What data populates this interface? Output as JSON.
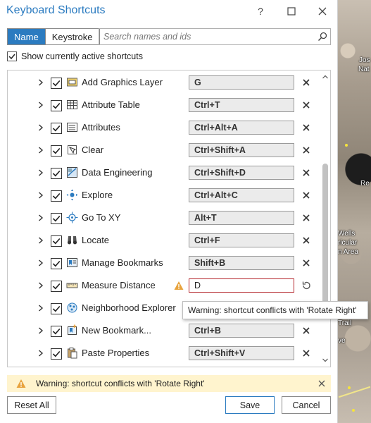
{
  "window": {
    "title": "Keyboard Shortcuts",
    "help_label": "?"
  },
  "toolbar": {
    "tab_name": "Name",
    "tab_keystroke": "Keystroke",
    "search_placeholder": "Search names and ids"
  },
  "show_active": {
    "label": "Show currently active shortcuts",
    "checked": true
  },
  "shortcuts": [
    {
      "name": "Add Graphics Layer",
      "key": "G",
      "icon": "graphics-layer-icon",
      "checked": true,
      "conflict": false
    },
    {
      "name": "Attribute Table",
      "key": "Ctrl+T",
      "icon": "table-icon",
      "checked": true,
      "conflict": false
    },
    {
      "name": "Attributes",
      "key": "Ctrl+Alt+A",
      "icon": "attributes-icon",
      "checked": true,
      "conflict": false
    },
    {
      "name": "Clear",
      "key": "Ctrl+Shift+A",
      "icon": "clear-selection-icon",
      "checked": true,
      "conflict": false
    },
    {
      "name": "Data Engineering",
      "key": "Ctrl+Shift+D",
      "icon": "data-engineering-icon",
      "checked": true,
      "conflict": false
    },
    {
      "name": "Explore",
      "key": "Ctrl+Alt+C",
      "icon": "explore-icon",
      "checked": true,
      "conflict": false
    },
    {
      "name": "Go To XY",
      "key": "Alt+T",
      "icon": "go-to-xy-icon",
      "checked": true,
      "conflict": false
    },
    {
      "name": "Locate",
      "key": "Ctrl+F",
      "icon": "binoculars-icon",
      "checked": true,
      "conflict": false
    },
    {
      "name": "Manage Bookmarks",
      "key": "Shift+B",
      "icon": "bookmarks-icon",
      "checked": true,
      "conflict": false
    },
    {
      "name": "Measure Distance",
      "key": "D",
      "icon": "ruler-icon",
      "checked": true,
      "conflict": true
    },
    {
      "name": "Neighborhood Explorer",
      "key": "",
      "icon": "neighborhood-icon",
      "checked": true,
      "conflict": false
    },
    {
      "name": "New Bookmark...",
      "key": "Ctrl+B",
      "icon": "new-bookmark-icon",
      "checked": true,
      "conflict": false
    },
    {
      "name": "Paste Properties",
      "key": "Ctrl+Shift+V",
      "icon": "paste-icon",
      "checked": true,
      "conflict": false
    }
  ],
  "tooltip": "Warning: shortcut conflicts with 'Rotate Right'",
  "warning_bar": {
    "text": "Warning: shortcut conflicts with 'Rotate Right'"
  },
  "buttons": {
    "reset_all": "Reset All",
    "save": "Save",
    "cancel": "Cancel"
  },
  "map": {
    "labels": [
      "Jos",
      "Nat",
      "Wells",
      "ricular",
      "n Area",
      "Trail",
      "ve",
      "Re"
    ]
  },
  "colors": {
    "accent": "#2b7bc0",
    "warning": "#e8a33d",
    "conflict_border": "#b4262c",
    "warning_bar_bg": "#fff4ce"
  }
}
